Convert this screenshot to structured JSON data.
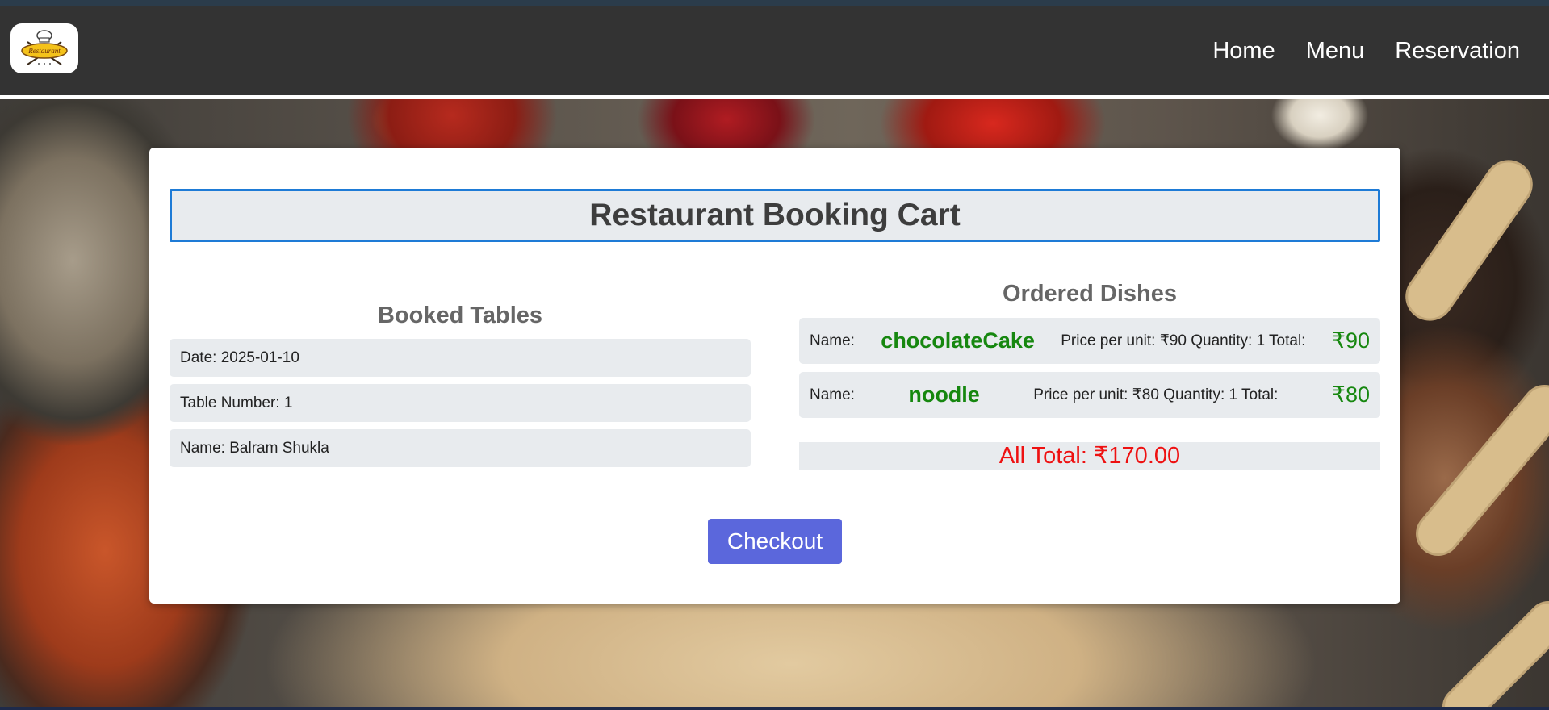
{
  "nav": {
    "logo_text": "Restaurant",
    "links": [
      "Home",
      "Menu",
      "Reservation"
    ]
  },
  "cart": {
    "title": "Restaurant Booking Cart",
    "booked": {
      "heading": "Booked Tables",
      "date": "Date: 2025-01-10",
      "table_number": "Table Number: 1",
      "name": "Name: Balram Shukla"
    },
    "ordered": {
      "heading": "Ordered Dishes",
      "dishes": [
        {
          "name_label": "Name:",
          "name": "chocolateCake",
          "details": "Price per unit: ₹90 Quantity: 1 Total:",
          "total": "₹90"
        },
        {
          "name_label": "Name:",
          "name": "noodle",
          "details": "Price per unit: ₹80 Quantity: 1 Total:",
          "total": "₹80"
        }
      ],
      "all_total": "All Total: ₹170.00"
    },
    "checkout_label": "Checkout"
  },
  "colors": {
    "nav_bg": "#333333",
    "title_border": "#1e7bd6",
    "dish_green": "#16870f",
    "total_red": "#ee1111",
    "checkout_bg": "#5b67dc"
  }
}
